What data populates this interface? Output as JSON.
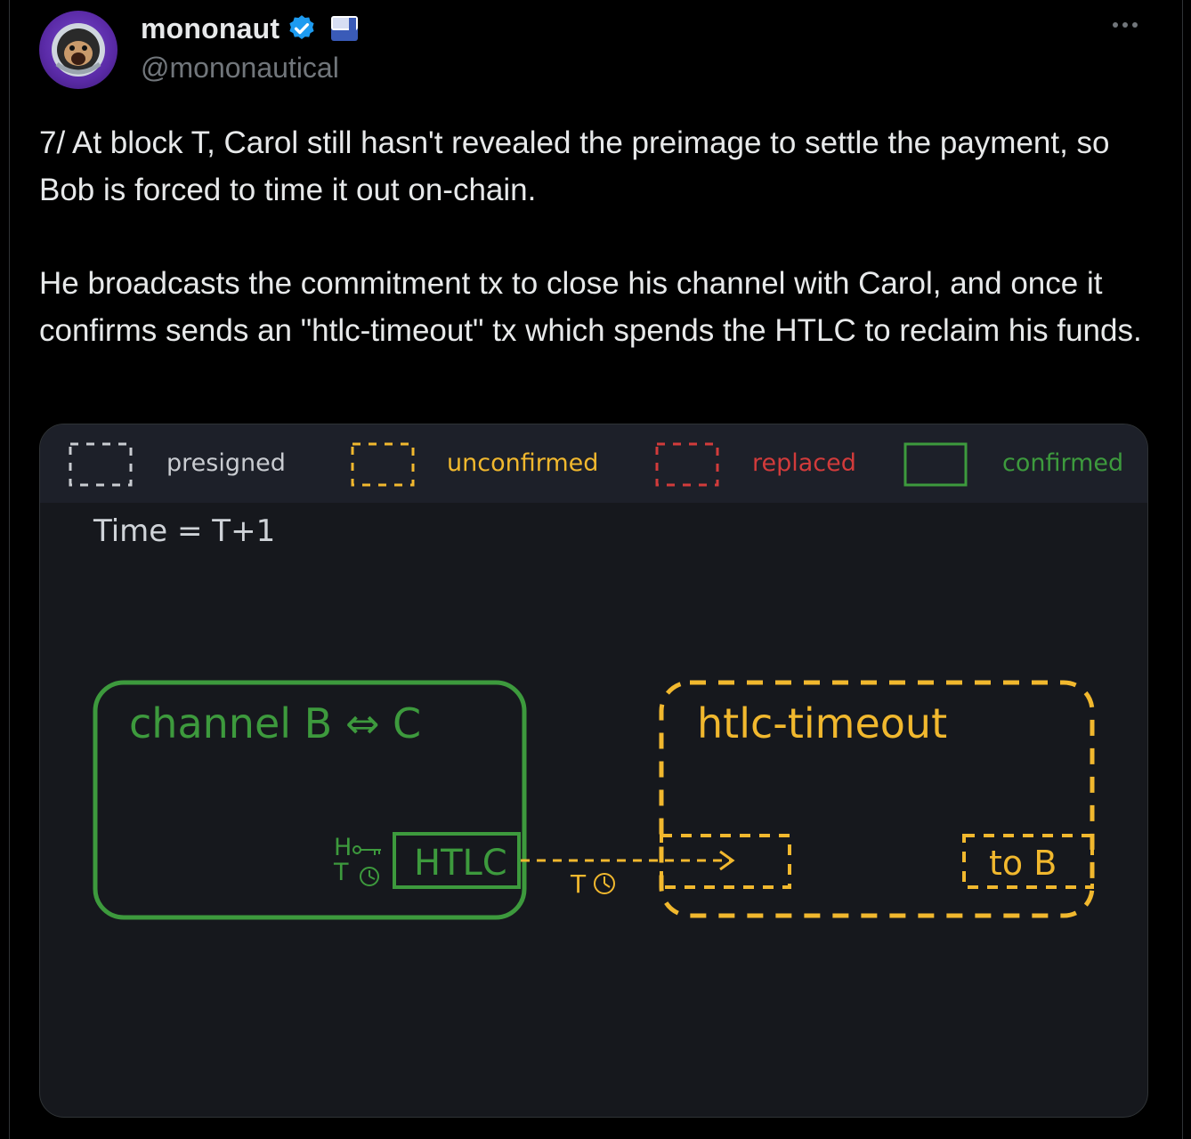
{
  "author": {
    "display_name": "mononaut",
    "handle": "@mononautical"
  },
  "tweet": {
    "paragraphs": [
      "7/ At block T, Carol still hasn't revealed the preimage to settle the payment, so Bob is forced to time it out on-chain.",
      "He broadcasts the commitment tx to close his channel with Carol, and once it confirms sends an \"htlc-timeout\" tx which spends the HTLC to reclaim his funds."
    ]
  },
  "media": {
    "legend": {
      "presigned": "presigned",
      "unconfirmed": "unconfirmed",
      "replaced": "replaced",
      "confirmed": "confirmed"
    },
    "time_label": "Time = T+1",
    "channel": {
      "title": "channel B ⇔ C",
      "hash_lock": "H",
      "time_lock": "T",
      "htlc": "HTLC"
    },
    "edge_time_lock": "T",
    "htlc_timeout": {
      "title": "htlc-timeout",
      "output": "to B"
    },
    "colors": {
      "presigned": "#c9ccd1",
      "unconfirmed": "#f1b82e",
      "replaced": "#d23b3b",
      "confirmed": "#3d9a3d"
    }
  },
  "icons": [
    "verified-badge-icon",
    "flag-icon",
    "more-icon",
    "key-icon",
    "clock-icon",
    "arrow-right-icon"
  ]
}
